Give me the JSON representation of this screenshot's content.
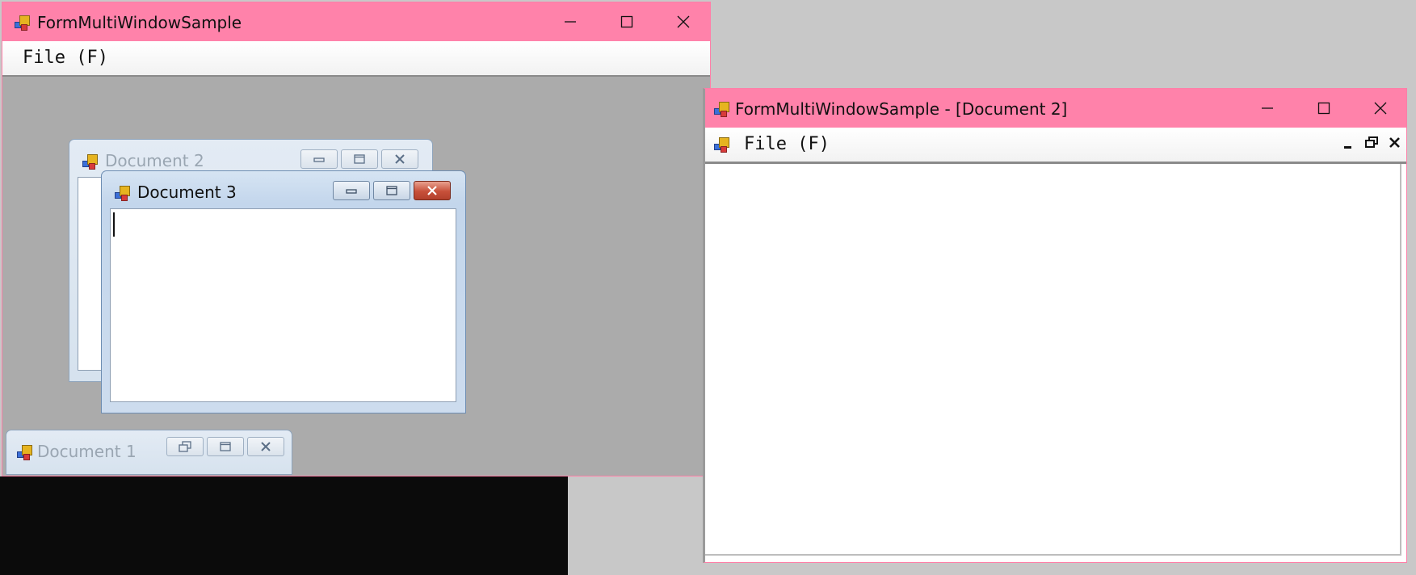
{
  "window_main": {
    "title": "FormMultiWindowSample",
    "menu": {
      "file_label": "File (F)"
    },
    "mdi_children": [
      {
        "title": "Document 2",
        "state": "inactive"
      },
      {
        "title": "Document 3",
        "state": "active"
      },
      {
        "title": "Document 1",
        "state": "minimized"
      }
    ]
  },
  "window_second": {
    "title": "FormMultiWindowSample - [Document 2]",
    "menu": {
      "file_label": "File (F)"
    }
  },
  "icons": {
    "app": "app-icon",
    "minimize": "minimize-icon",
    "maximize": "maximize-icon",
    "restore": "restore-icon",
    "close": "close-icon"
  },
  "colors": {
    "titlebar_pink": "#ff82aa",
    "mdi_background": "#ababab",
    "desktop": "#c8c8c8",
    "aero_blue": "#c3d6ec",
    "close_red": "#c7503a"
  }
}
